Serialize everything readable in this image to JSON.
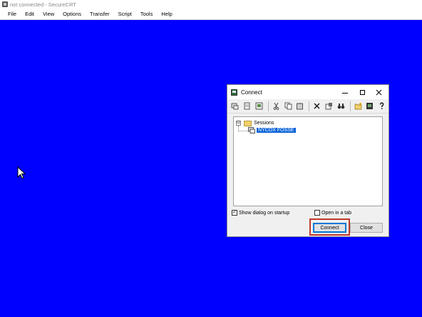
{
  "window": {
    "title": "not connected - SecureCRT"
  },
  "menu": {
    "items": [
      "File",
      "Edit",
      "View",
      "Options",
      "Transfer",
      "Script",
      "Tools",
      "Help"
    ]
  },
  "dialog": {
    "title": "Connect",
    "toolbar_icons": [
      "connect-icon",
      "quick-connect-icon",
      "new-session-icon",
      "cut-icon",
      "copy-icon",
      "paste-icon",
      "delete-icon",
      "properties-icon",
      "find-icon",
      "new-folder-icon",
      "desktop-shortcut-icon",
      "help-icon"
    ],
    "tree": {
      "root_label": "Sessions",
      "root_expander": "⊟",
      "selected_session": "NYCOX FOSSE"
    },
    "options": {
      "show_dialog_label": "Show dialog on startup",
      "show_dialog_checked": true,
      "open_in_tab_label": "Open in a tab",
      "open_in_tab_checked": false
    },
    "buttons": {
      "connect": "Connect",
      "close": "Close"
    },
    "highlight_color": "#c0392b"
  }
}
